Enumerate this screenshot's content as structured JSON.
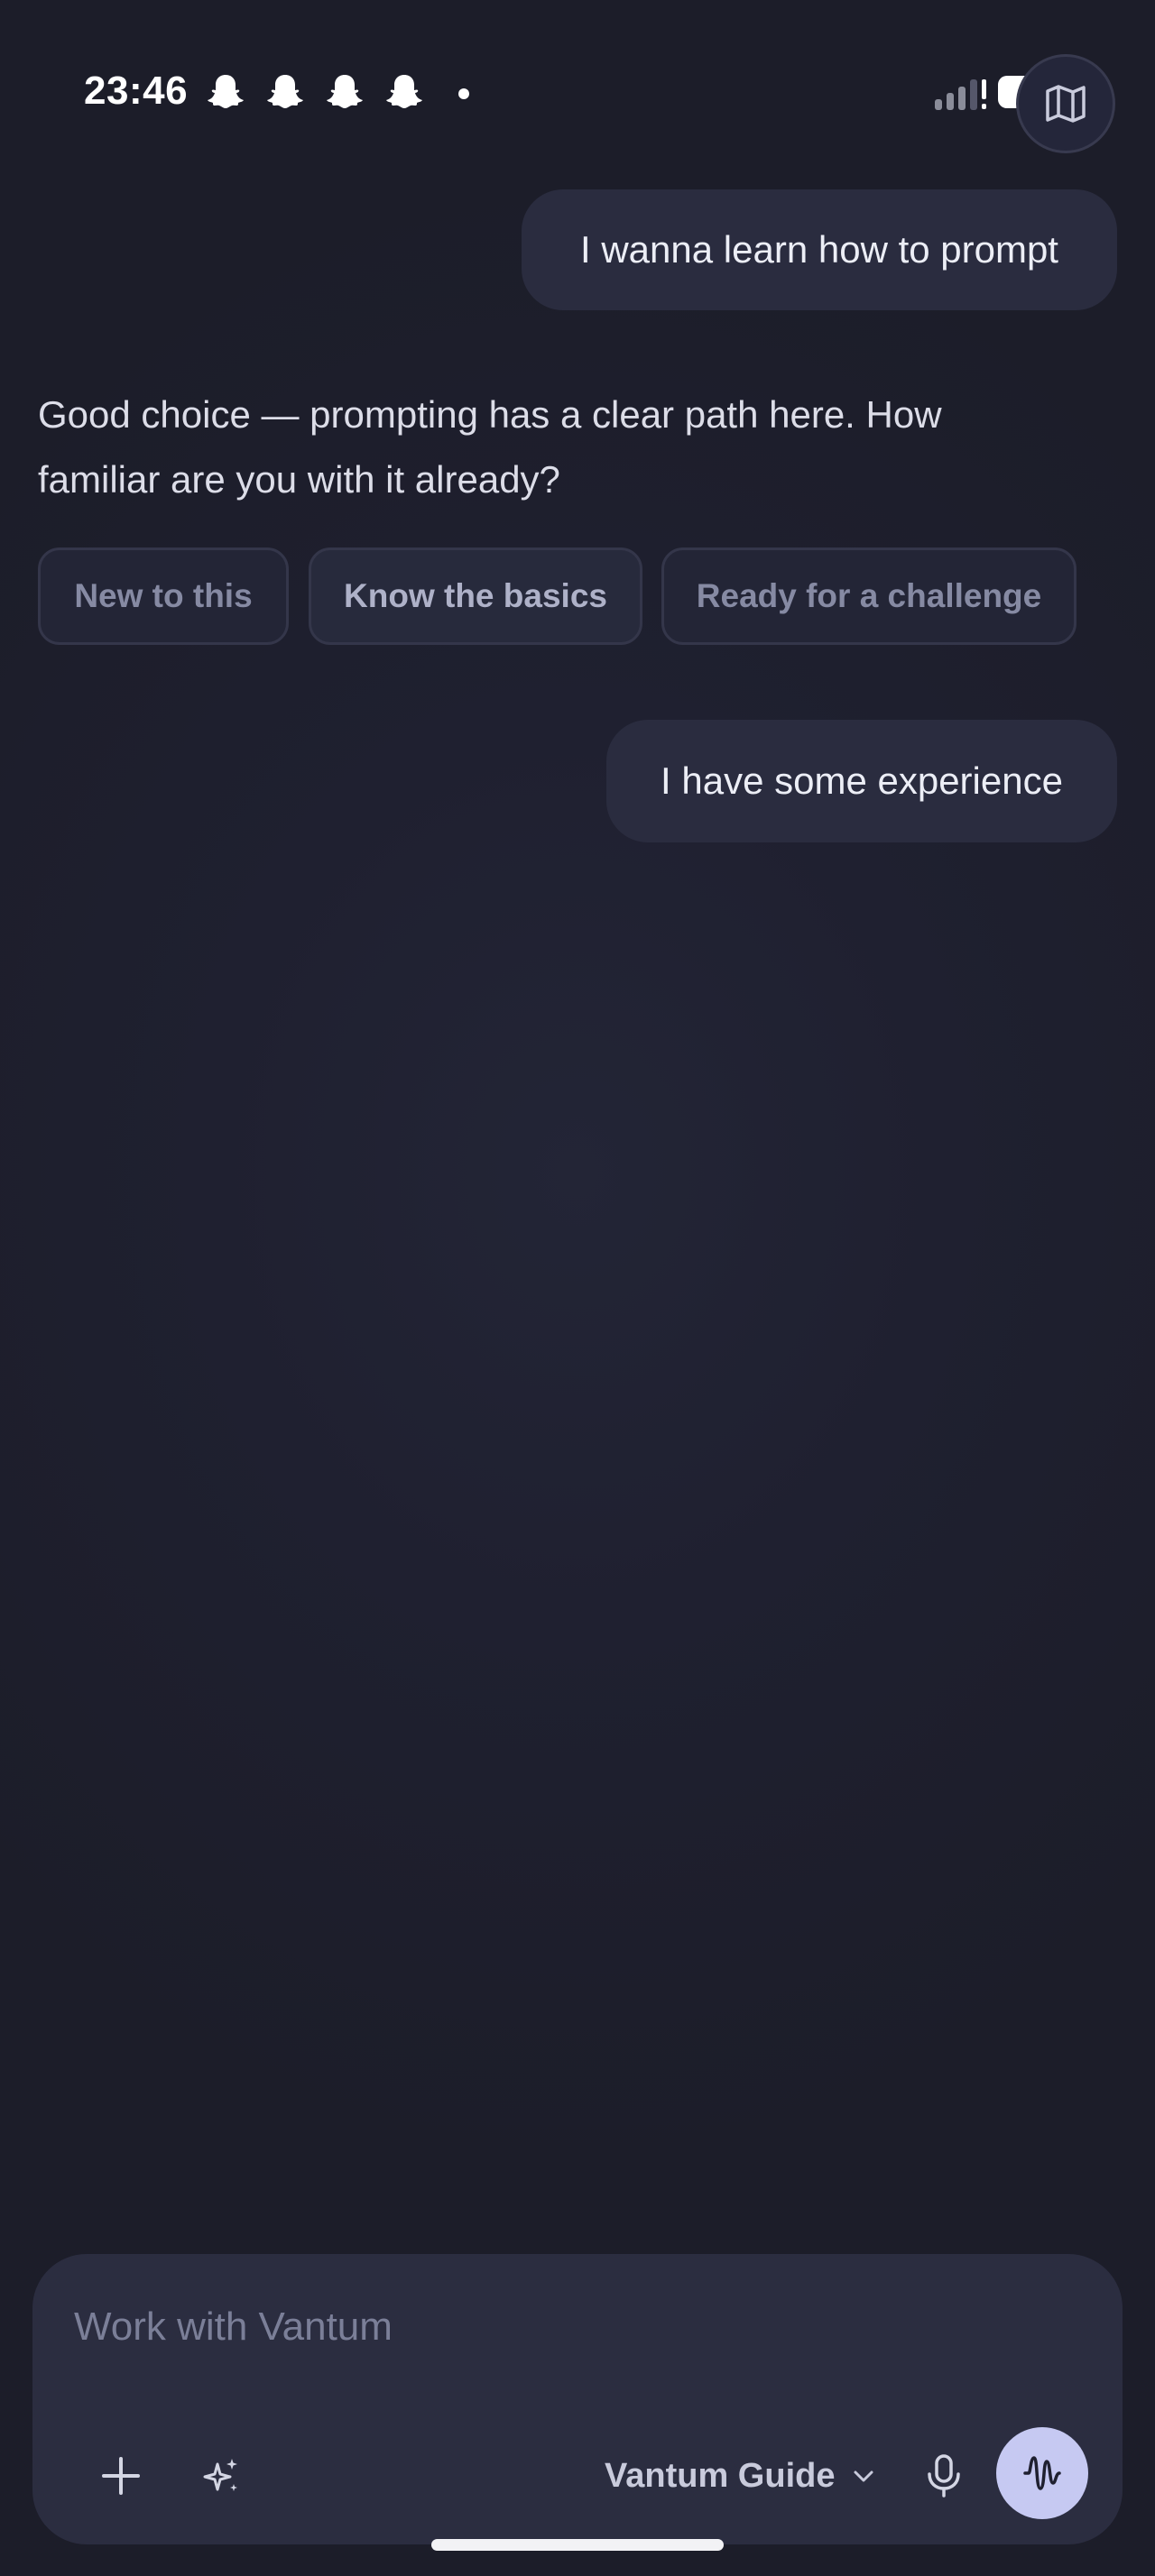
{
  "status_bar": {
    "time": "23:46",
    "notification_icons": [
      "snapchat-ghost-icon",
      "snapchat-ghost-icon",
      "snapchat-ghost-icon",
      "snapchat-ghost-icon"
    ],
    "signal_icon": "cellular-signal-alert-icon",
    "battery_icon": "battery-icon"
  },
  "header": {
    "map_button_icon": "map-icon"
  },
  "conversation": {
    "user_message_1": "I wanna learn how to prompt",
    "assistant_message": "Good choice — prompting has a clear path here. How familiar are you with it already?",
    "options": [
      "New to this",
      "Know the basics",
      "Ready for a challenge"
    ],
    "user_message_2": "I have some experience"
  },
  "composer": {
    "placeholder": "Work with Vantum",
    "model_selector": "Vantum Guide",
    "icons": [
      "plus-icon",
      "sparkle-icon",
      "chevron-down-icon",
      "microphone-icon",
      "waveform-icon"
    ]
  },
  "colors": {
    "background": "#1e1f2c",
    "bubble": "#2a2c3f",
    "composer": "#2b2d40",
    "voice_button": "#c6c9f2"
  }
}
